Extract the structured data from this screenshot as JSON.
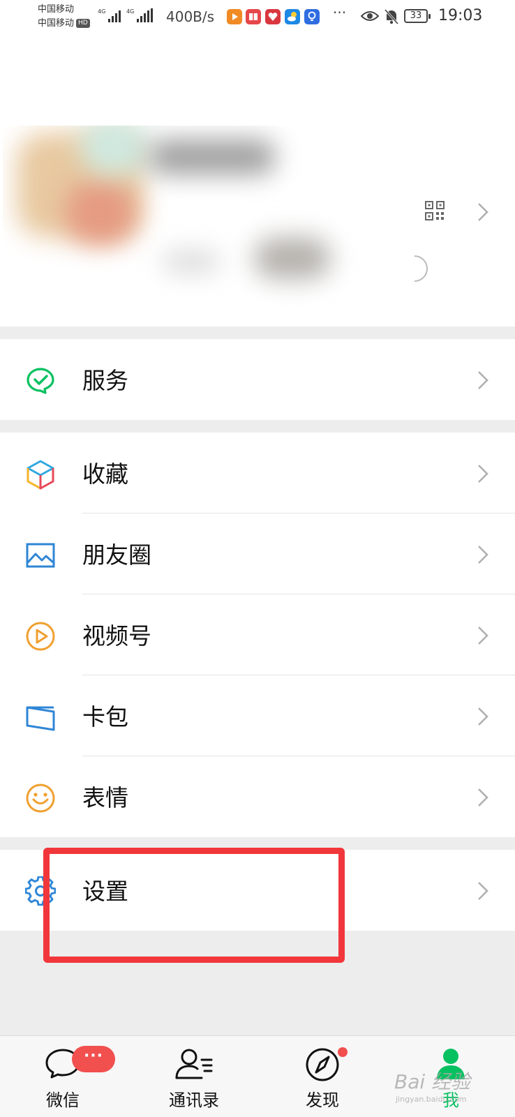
{
  "status_bar": {
    "carrier_1": "中国移动",
    "carrier_2": "中国移动",
    "hd_badge": "HD",
    "signal_1_tag": "4G",
    "signal_2_tag": "4G",
    "net_speed": "400B/s",
    "app_icons": [
      "video-app-icon",
      "book-app-icon",
      "heart-app-icon",
      "weather-app-icon",
      "bulb-app-icon"
    ],
    "more": "···",
    "battery": "33",
    "time": "19:03"
  },
  "profile": {
    "icons": [
      "qr-code-icon",
      "chevron-right-icon"
    ]
  },
  "menu": {
    "service": {
      "label": "服务",
      "icon": "service-icon"
    },
    "favorites": {
      "label": "收藏",
      "icon": "favorites-cube-icon"
    },
    "moments": {
      "label": "朋友圈",
      "icon": "moments-image-icon"
    },
    "channels": {
      "label": "视频号",
      "icon": "channels-play-icon"
    },
    "cards": {
      "label": "卡包",
      "icon": "card-wallet-icon"
    },
    "stickers": {
      "label": "表情",
      "icon": "smiley-icon"
    },
    "settings": {
      "label": "设置",
      "icon": "gear-icon"
    }
  },
  "tabs": {
    "chats": {
      "label": "微信",
      "badge": "···"
    },
    "contacts": {
      "label": "通讯录"
    },
    "discover": {
      "label": "发现"
    },
    "me": {
      "label": "我"
    }
  },
  "watermark": {
    "main": "Bai 经验",
    "sub": "jingyan.baidu.com"
  },
  "colors": {
    "accent_green": "#07c160",
    "badge_red": "#f24f4f",
    "highlight_red": "#f1373b",
    "background": "#ededed"
  }
}
